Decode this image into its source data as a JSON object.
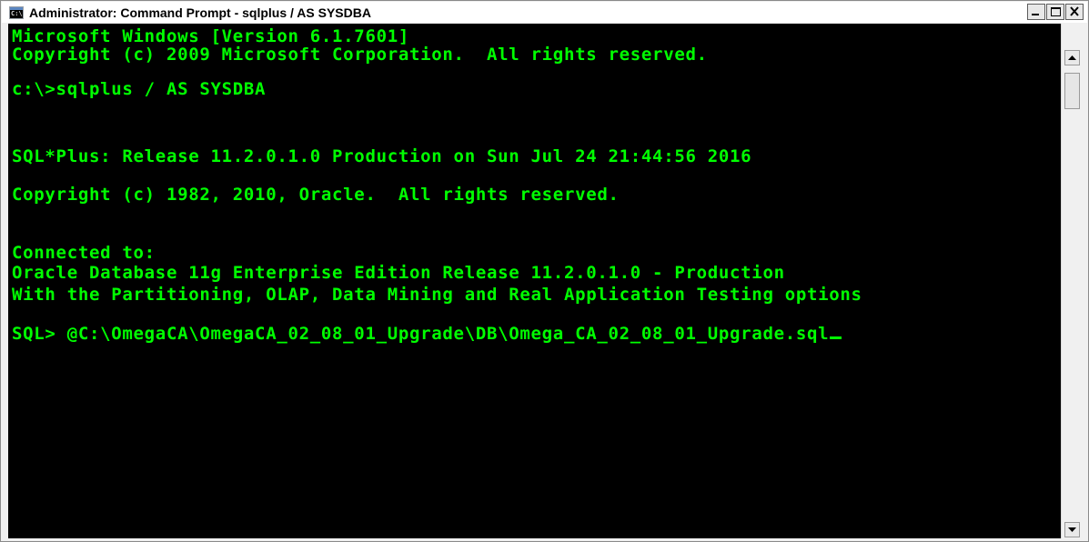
{
  "window": {
    "title": "Administrator: Command Prompt - sqlplus  / AS SYSDBA",
    "icon_label": "C:\\",
    "icon": "cmd-app-icon"
  },
  "caption_buttons": {
    "minimize_icon": "minimize-icon",
    "maximize_icon": "maximize-icon",
    "close_icon": "close-icon"
  },
  "console": {
    "text_color": "#00ff00",
    "background_color": "#000000",
    "lines": [
      "Microsoft Windows [Version 6.1.7601]",
      "Copyright (c) 2009 Microsoft Corporation.  All rights reserved.",
      "c:\\>sqlplus / AS SYSDBA",
      "SQL*Plus: Release 11.2.0.1.0 Production on Sun Jul 24 21:44:56 2016",
      "Copyright (c) 1982, 2010, Oracle.  All rights reserved.",
      "Connected to:",
      "Oracle Database 11g Enterprise Edition Release 11.2.0.1.0 - Production",
      "With the Partitioning, OLAP, Data Mining and Real Application Testing options",
      "SQL> @C:\\OmegaCA\\OmegaCA_02_08_01_Upgrade\\DB\\Omega_CA_02_08_01_Upgrade.sql"
    ]
  },
  "scrollbar": {
    "up_icon": "scroll-up-arrow-icon",
    "down_icon": "scroll-down-arrow-icon"
  }
}
